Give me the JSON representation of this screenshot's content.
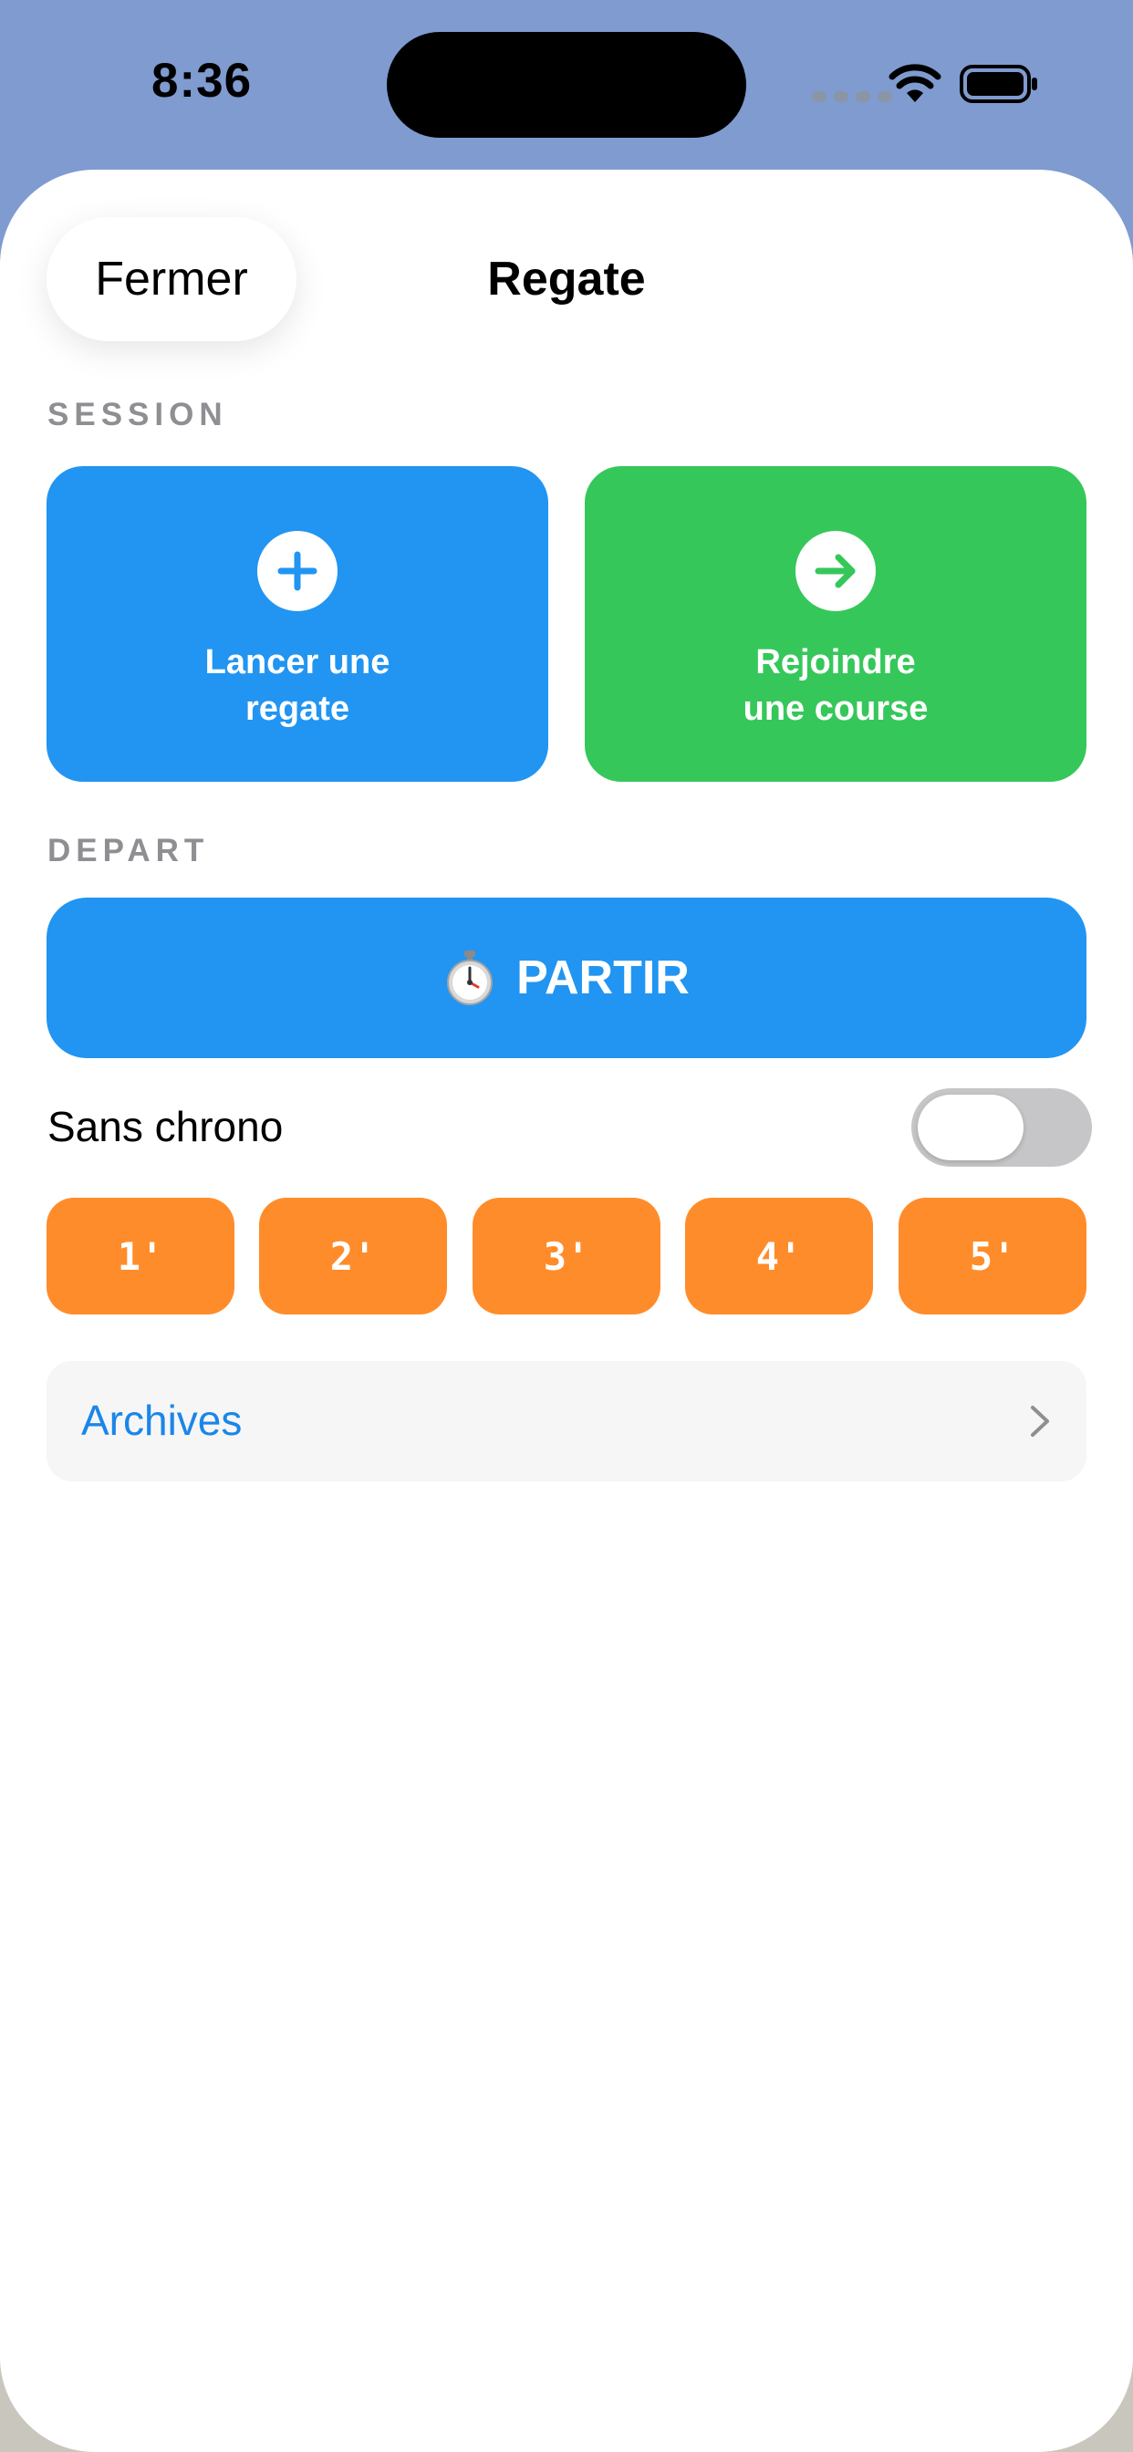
{
  "status_bar": {
    "time": "8:36",
    "icons": [
      "signal-dots-icon",
      "wifi-icon",
      "battery-icon"
    ]
  },
  "sheet": {
    "close_label": "Fermer",
    "title": "Regate"
  },
  "session": {
    "section_label": "SESSION",
    "launch": {
      "icon": "plus-icon",
      "label_line1": "Lancer une",
      "label_line2": "regate"
    },
    "join": {
      "icon": "arrow-right-icon",
      "label_line1": "Rejoindre",
      "label_line2": "une course"
    }
  },
  "depart": {
    "section_label": "DEPART",
    "start_icon": "stopwatch-icon",
    "start_label": "PARTIR",
    "no_timer_label": "Sans chrono",
    "no_timer_enabled": false,
    "minutes": [
      "1'",
      "2'",
      "3'",
      "4'",
      "5'"
    ]
  },
  "archives": {
    "label": "Archives",
    "icon": "chevron-right-icon"
  },
  "colors": {
    "accent_blue": "#2195f1",
    "accent_green": "#36c75a",
    "accent_orange": "#ff8c2a",
    "link_blue": "#1a86e8",
    "backdrop": "#7f9bd0"
  }
}
